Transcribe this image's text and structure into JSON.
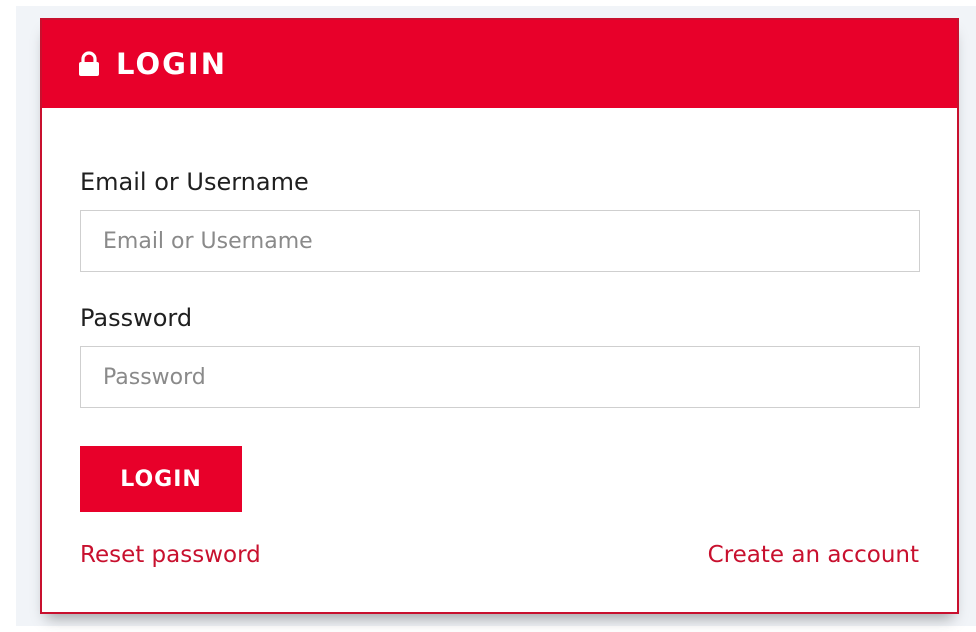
{
  "header": {
    "title": "LOGIN",
    "icon": "lock-icon"
  },
  "form": {
    "email_label": "Email or Username",
    "email_placeholder": "Email or Username",
    "email_value": "",
    "password_label": "Password",
    "password_placeholder": "Password",
    "password_value": "",
    "submit_label": "LOGIN"
  },
  "links": {
    "reset": "Reset password",
    "create": "Create an account"
  },
  "colors": {
    "brand": "#e8002a",
    "border": "#c8102e",
    "link": "#c8102e",
    "background": "#f1f4f8"
  }
}
